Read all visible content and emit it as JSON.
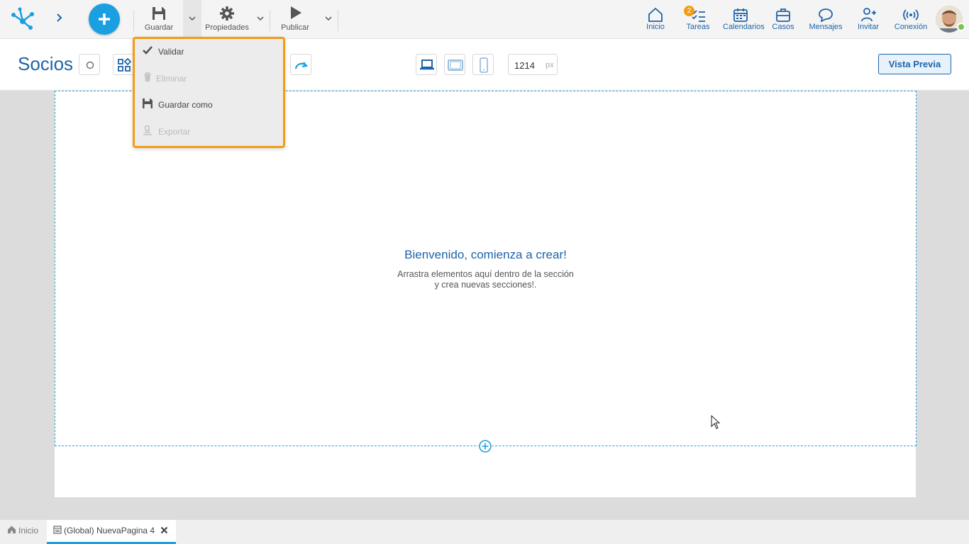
{
  "toolbar": {
    "save_label": "Guardar",
    "properties_label": "Propiedades",
    "publish_label": "Publicar"
  },
  "nav": {
    "home_label": "Inicio",
    "tasks_label": "Tareas",
    "tasks_count": "2",
    "calendars_label": "Calendarios",
    "cases_label": "Casos",
    "messages_label": "Mensajes",
    "invite_label": "Invitar",
    "connection_label": "Conexión"
  },
  "editor": {
    "page_title": "Socios",
    "width_value": "1214",
    "width_unit": "px",
    "preview_label": "Vista Previa"
  },
  "save_menu": {
    "items": [
      {
        "label": "Validar",
        "icon": "check-icon",
        "enabled": true
      },
      {
        "label": "Eliminar",
        "icon": "trash-icon",
        "enabled": false
      },
      {
        "label": "Guardar como",
        "icon": "save-icon",
        "enabled": true
      },
      {
        "label": "Exportar",
        "icon": "export-icon",
        "enabled": false
      }
    ]
  },
  "canvas": {
    "welcome_title": "Bienvenido, comienza a crear!",
    "welcome_line1": "Arrastra elementos aquí dentro de la sección",
    "welcome_line2": "y crea nuevas secciones!."
  },
  "tabs": {
    "home_label": "Inicio",
    "active_label": "(Global) NuevaPagina 4"
  },
  "colors": {
    "accent": "#1a9fe0",
    "brand_blue": "#1e64a8",
    "highlight_orange": "#f39c12",
    "online_green": "#7bc34a"
  }
}
